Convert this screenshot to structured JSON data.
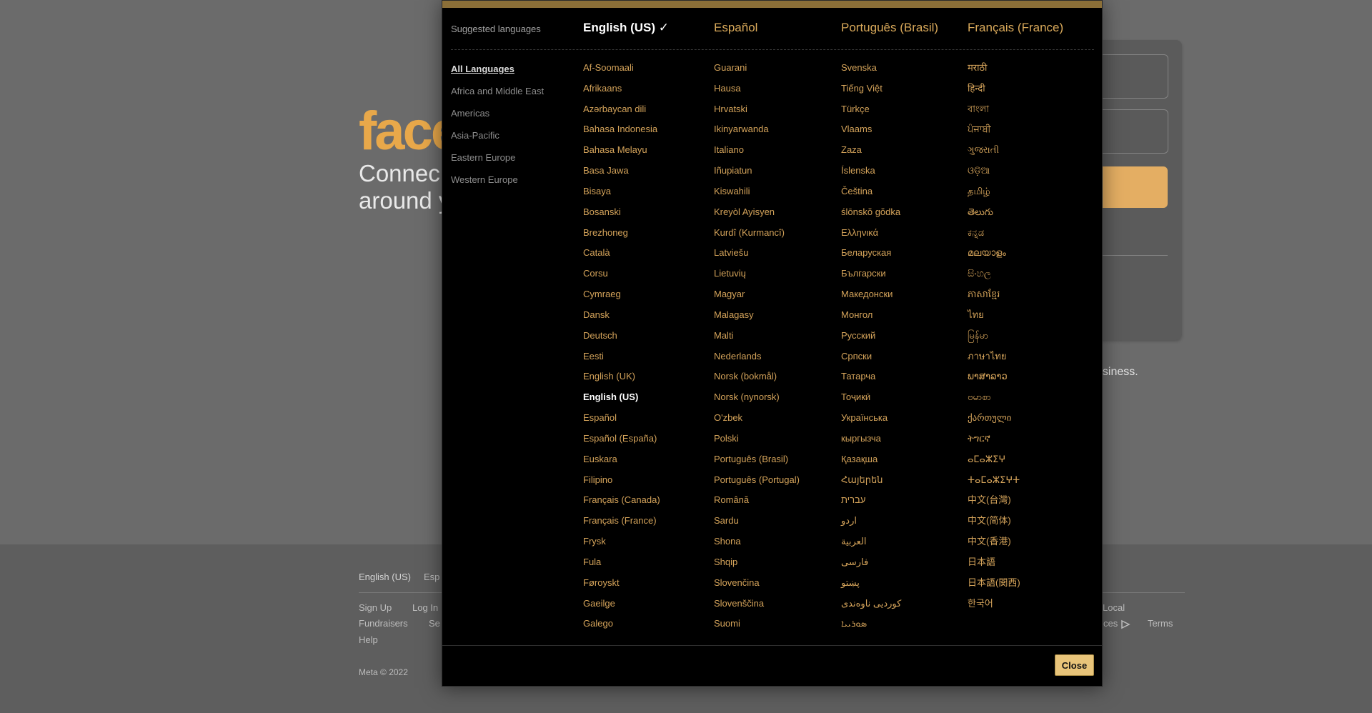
{
  "background": {
    "logo_text": "face",
    "tagline": "Connec around y",
    "business_text": "usiness.",
    "footer": {
      "row1": [
        "English (US)",
        "Esp"
      ],
      "row2": [
        "Sign Up",
        "Log In"
      ],
      "row2_right": "Local",
      "row3": [
        "Fundraisers",
        "Se"
      ],
      "row3_right": [
        "ces",
        "Terms"
      ],
      "row4": [
        "Help"
      ],
      "copyright": "Meta © 2022"
    }
  },
  "modal": {
    "suggested_label": "Suggested languages",
    "suggested": [
      {
        "label": "English (US) ✓",
        "current": true
      },
      {
        "label": "Español",
        "current": false
      },
      {
        "label": "Português (Brasil)",
        "current": false
      },
      {
        "label": "Français (France)",
        "current": false
      }
    ],
    "regions": [
      {
        "label": "All Languages",
        "active": true
      },
      {
        "label": "Africa and Middle East",
        "active": false
      },
      {
        "label": "Americas",
        "active": false
      },
      {
        "label": "Asia-Pacific",
        "active": false
      },
      {
        "label": "Eastern Europe",
        "active": false
      },
      {
        "label": "Western Europe",
        "active": false
      }
    ],
    "columns": [
      [
        "Af-Soomaali",
        "Afrikaans",
        "Azərbaycan dili",
        "Bahasa Indonesia",
        "Bahasa Melayu",
        "Basa Jawa",
        "Bisaya",
        "Bosanski",
        "Brezhoneg",
        "Català",
        "Corsu",
        "Cymraeg",
        "Dansk",
        "Deutsch",
        "Eesti",
        "English (UK)",
        "English (US)",
        "Español",
        "Español (España)",
        "Euskara",
        "Filipino",
        "Français (Canada)",
        "Français (France)",
        "Frysk",
        "Fula",
        "Føroyskt",
        "Gaeilge",
        "Galego"
      ],
      [
        "Guarani",
        "Hausa",
        "Hrvatski",
        "Ikinyarwanda",
        "Italiano",
        "Iñupiatun",
        "Kiswahili",
        "Kreyòl Ayisyen",
        "Kurdî (Kurmancî)",
        "Latviešu",
        "Lietuvių",
        "Magyar",
        "Malagasy",
        "Malti",
        "Nederlands",
        "Norsk (bokmål)",
        "Norsk (nynorsk)",
        "O'zbek",
        "Polski",
        "Português (Brasil)",
        "Português (Portugal)",
        "Română",
        "Sardu",
        "Shona",
        "Shqip",
        "Slovenčina",
        "Slovenščina",
        "Suomi"
      ],
      [
        "Svenska",
        "Tiếng Việt",
        "Türkçe",
        "Vlaams",
        "Zaza",
        "Íslenska",
        "Čeština",
        "ślōnskŏ gŏdka",
        "Ελληνικά",
        "Беларуская",
        "Български",
        "Македонски",
        "Монгол",
        "Русский",
        "Српски",
        "Татарча",
        "Тоҷикӣ",
        "Українська",
        "кыргызча",
        "Қазақша",
        "Հայերեն",
        "עברית",
        "اردو",
        "العربية",
        "فارسی",
        "پښتو",
        "کوردیی ناوەندی",
        "ܣܘܪܝܝܐ"
      ],
      [
        "मराठी",
        "हिन्दी",
        "বাংলা",
        "ਪੰਜਾਬੀ",
        "ગુજરાતી",
        "ଓଡ଼ିଆ",
        "தமிழ்",
        "తెలుగు",
        "ಕನ್ನಡ",
        "മലയാളം",
        "සිංහල",
        "ភាសាខ្មែរ",
        "ไทย",
        "မြန်မာ",
        "ภาษาไทย",
        "ພາສາລາວ",
        "ဗမာစာ",
        "ქართული",
        "ትግርኛ",
        "ⴰⵎⴰⵣⵉⵖ",
        "ⵜⴰⵎⴰⵣⵉⵖⵜ",
        "中文(台灣)",
        "中文(简体)",
        "中文(香港)",
        "日本語",
        "日本語(関西)",
        "한국어"
      ]
    ],
    "current_language": "English (US)",
    "close_label": "Close"
  }
}
